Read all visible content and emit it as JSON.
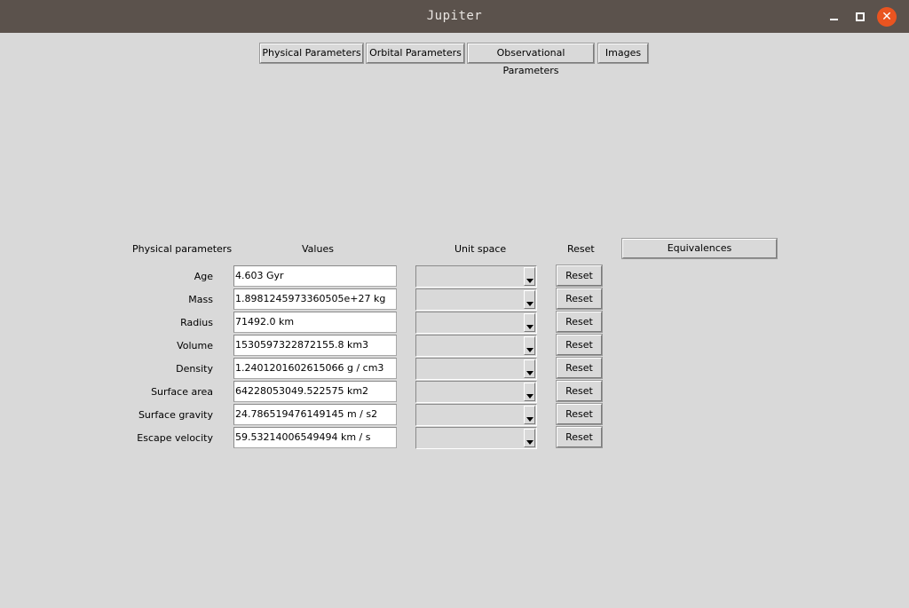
{
  "window": {
    "title": "Jupiter",
    "minimize_icon": "minimize-icon",
    "maximize_icon": "maximize-icon",
    "close_icon": "close-icon",
    "close_color": "#e95420"
  },
  "tabs": [
    {
      "label": "Physical Parameters"
    },
    {
      "label": "Orbital Parameters"
    },
    {
      "label": "Observational Parameters"
    },
    {
      "label": "Images"
    }
  ],
  "table": {
    "headers": {
      "parameter": "Physical parameters",
      "values": "Values",
      "unit_space": "Unit space",
      "reset": "Reset"
    },
    "equivalences_label": "Equivalences",
    "rows": [
      {
        "label": "Age",
        "value": "4.603 Gyr",
        "unit": "",
        "reset": "Reset"
      },
      {
        "label": "Mass",
        "value": "1.8981245973360505e+27 kg",
        "unit": "",
        "reset": "Reset"
      },
      {
        "label": "Radius",
        "value": "71492.0 km",
        "unit": "",
        "reset": "Reset"
      },
      {
        "label": "Volume",
        "value": "1530597322872155.8 km3",
        "unit": "",
        "reset": "Reset"
      },
      {
        "label": "Density",
        "value": "1.2401201602615066 g / cm3",
        "unit": "",
        "reset": "Reset"
      },
      {
        "label": "Surface area",
        "value": "64228053049.522575 km2",
        "unit": "",
        "reset": "Reset"
      },
      {
        "label": "Surface gravity",
        "value": "24.786519476149145 m / s2",
        "unit": "",
        "reset": "Reset"
      },
      {
        "label": "Escape velocity",
        "value": "59.53214006549494 km / s",
        "unit": "",
        "reset": "Reset"
      }
    ]
  }
}
